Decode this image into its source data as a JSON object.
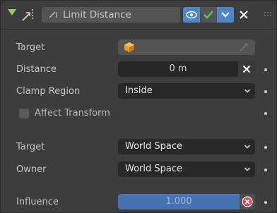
{
  "header": {
    "constraint_name": "Limit Distance",
    "icons": {
      "collapse": "disclosure-triangle-icon",
      "constraint": "limit-distance-constraint-icon",
      "eye": "eye-icon",
      "check": "check-icon",
      "chevron": "chevron-down-icon",
      "close": "close-icon",
      "grip": "drag-grip-icon"
    },
    "accent_color": "#4f86c6",
    "check_color": "#59c94a"
  },
  "rows": {
    "target": {
      "label": "Target",
      "value": ""
    },
    "distance": {
      "label": "Distance",
      "value": "0 m"
    },
    "clamp_region": {
      "label": "Clamp Region",
      "value": "Inside"
    },
    "affect_transform": {
      "label": "Affect Transform",
      "checked": false
    },
    "target_space": {
      "label": "Target",
      "value": "World Space"
    },
    "owner_space": {
      "label": "Owner",
      "value": "World Space"
    },
    "influence": {
      "label": "Influence",
      "value": "1.000",
      "fraction": 1.0
    }
  }
}
